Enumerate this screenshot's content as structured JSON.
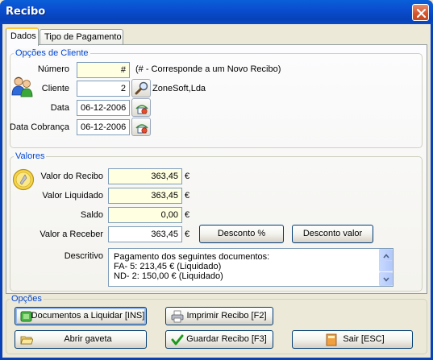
{
  "window": {
    "title": "Recibo"
  },
  "tabs": [
    {
      "label": "Dados",
      "active": true
    },
    {
      "label": "Tipo de Pagamento",
      "active": false
    }
  ],
  "cliente_group": {
    "title": "Opções de Cliente",
    "numero": {
      "label": "Número",
      "value": "#",
      "note": "(# - Corresponde a um Novo Recibo)"
    },
    "cliente": {
      "label": "Cliente",
      "value": "2",
      "name": "ZoneSoft,Lda"
    },
    "data": {
      "label": "Data",
      "value": "06-12-2006"
    },
    "data_cobranca": {
      "label": "Data Cobrança",
      "value": "06-12-2006"
    }
  },
  "valores_group": {
    "title": "Valores",
    "currency": "€",
    "valor_recibo": {
      "label": "Valor do Recibo",
      "value": "363,45"
    },
    "valor_liquidado": {
      "label": "Valor Liquidado",
      "value": "363,45"
    },
    "saldo": {
      "label": "Saldo",
      "value": "0,00"
    },
    "valor_receber": {
      "label": "Valor a Receber",
      "value": "363,45"
    },
    "desconto_pct_label": "Desconto %",
    "desconto_valor_label": "Desconto valor",
    "descritivo": {
      "label": "Descritivo",
      "lines": [
        "Pagamento dos seguintes documentos:",
        "FA-  5: 213,45 € (Liquidado)",
        "ND-  2: 150,00 € (Liquidado)"
      ]
    }
  },
  "opcoes_group": {
    "title": "Opções",
    "documentos_label": "Documentos a Liquidar [INS]",
    "imprimir_label": "Imprimir Recibo [F2]",
    "abrir_label": "Abrir gaveta",
    "guardar_label": "Guardar Recibo [F3]",
    "sair_label": "Sair [ESC]"
  },
  "colors": {
    "titlebar": "#0a4ed0",
    "group_title": "#0046d5",
    "highlight_field": "#ffffe1",
    "close_button": "#d3532a"
  }
}
